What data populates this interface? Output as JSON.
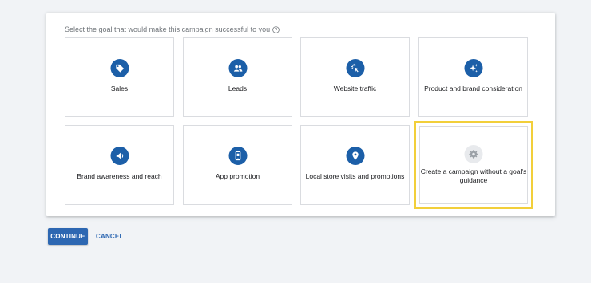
{
  "prompt": "Select the goal that would make this campaign successful to you",
  "goals": [
    {
      "label": "Sales",
      "icon": "tag-icon"
    },
    {
      "label": "Leads",
      "icon": "people-icon"
    },
    {
      "label": "Website traffic",
      "icon": "cursor-click-icon"
    },
    {
      "label": "Product and brand consideration",
      "icon": "sparkle-icon"
    },
    {
      "label": "Brand awareness and reach",
      "icon": "speaker-icon"
    },
    {
      "label": "App promotion",
      "icon": "phone-icon"
    },
    {
      "label": "Local store visits and promotions",
      "icon": "location-pin-icon"
    },
    {
      "label": "Create a campaign without a goal's guidance",
      "icon": "gear-icon",
      "selected": true
    }
  ],
  "actions": {
    "continue_label": "CONTINUE",
    "cancel_label": "CANCEL"
  },
  "colors": {
    "accent": "#2d67b2",
    "icon_bg": "#1c5fa8",
    "selected_border": "#f2cf3a"
  }
}
